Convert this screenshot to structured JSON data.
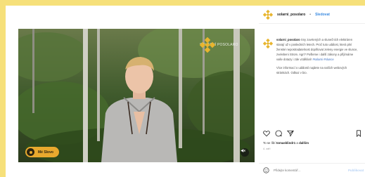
{
  "post": {
    "username": "solarni_posolaro",
    "separator": "•",
    "follow_label": "Sledovat",
    "caption_username": "solarni_posolaro",
    "caption_lines": [
      "Sny zavrtených a",
      "slunečních elektráren starají už v",
      "posledních letech. Proč tuto událost, která plní",
      "ženské nepostradatelnost doplňovat",
      "zeleny energie ve slunce, zvelebeni",
      "Strom. Agri? Pošleme i další",
      "zákony a příjímáme vaše dotazy i zde",
      "vzdělání!"
    ],
    "tags": "#solarni #slunce",
    "caption_more": "Více informací o událostí najdete na naších webových stránkách. Odkaz v bio.",
    "likes_prefix": "To se líbí",
    "likes_user1": "tomasklindr1",
    "likes_and": "a",
    "likes_others": "dalším",
    "date": "4. září",
    "comment_placeholder": "Přidejte komentář…",
    "post_button": "Publikovat"
  },
  "media": {
    "watermark_text": "SOLÁRNÍ POSOLARO",
    "badge_text": "Mé Slovo",
    "mute_icon": "speaker-muted-icon"
  },
  "icons": {
    "logo": "diamond-flower-logo-icon",
    "like": "heart-icon",
    "comment": "comment-icon",
    "share": "send-icon",
    "save": "bookmark-icon"
  },
  "colors": {
    "background": "#f6e07a",
    "brand": "#e8b52e",
    "badge": "#e8a92e",
    "link": "#3b8be0"
  }
}
